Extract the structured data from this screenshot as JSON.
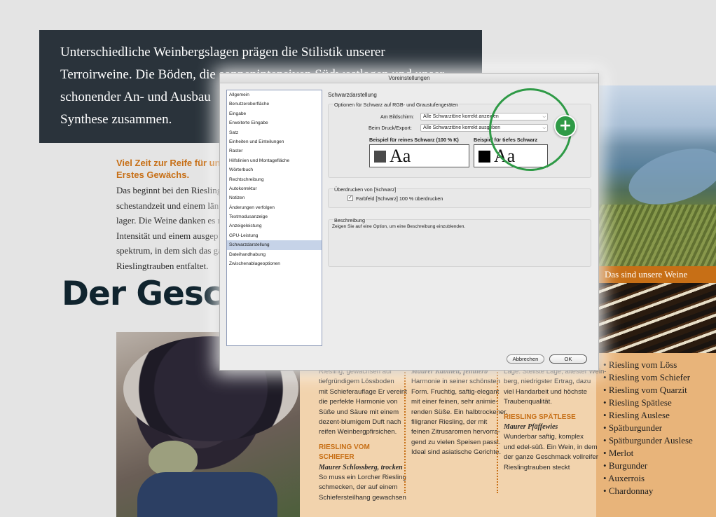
{
  "brochure": {
    "intro_lines": [
      "Unterschiedliche Weinbergslagen prägen die Stilistik unserer",
      "Terroirweine. Die Böden, die sonnenintensiven Südwestlagen und unser",
      "schonender An- und Ausbau",
      "Synthese zusammen."
    ],
    "orange_heading_lines": [
      "Viel Zeit zur Reife für un",
      "Erstes Gewächs."
    ],
    "body_lines": [
      "Das beginnt bei den Rieslinge",
      "schestandzeit und einem län",
      "lager. Die Weine danken es r",
      "Intensität und einem ausgep",
      "spektrum, in dem sich das ga",
      "Rieslingtrauben entfaltet."
    ],
    "big_heading": "Der Gesch",
    "band_title": "Das sind unsere Weine",
    "wine_list": [
      "Riesling vom Löss",
      "Riesling vom Schiefer",
      "Riesling vom Quarzit",
      "Riesling Spätlese",
      "Riesling Auslese",
      "Spätburgunder",
      "Spätburgunder Auslese",
      "Merlot",
      "Burgunder",
      "Auxerrois",
      "Chardonnay"
    ],
    "col1": {
      "lines": [
        "Riesling, gewachsen auf",
        "tiefgründigem Lössboden",
        "mit Schieferauflage Er vereint",
        "die perfekte Harmonie von",
        "Süße und Säure mit einem",
        "dezent-blumigem Duft nach",
        "reifen Weinbergpfirsichen."
      ],
      "heading_lines": [
        "RIESLING VOM",
        "SCHIEFER"
      ],
      "subtitle": "Maurer Schlossberg, trocken",
      "lines2": [
        "So muss ein Lorcher Riesling",
        "schmecken, der auf einem",
        "Schiefersteilhang gewachsen"
      ]
    },
    "col2": {
      "subtitle": "Maurer Kabinett, feinherb",
      "lines": [
        "Harmonie in seiner schönsten",
        "Form. Fruchtig, saftig-elegant",
        "mit einer feinen, sehr animie-",
        "renden Süße. Ein halbtrockener,",
        "filigraner Riesling, der mit",
        "feinen Zitrusaromen hervorra-",
        "gend zu vielen Speisen passt.",
        "Ideal sind asiatische Gerichte."
      ]
    },
    "col3": {
      "lines": [
        "Lage. Steilste Lage, ältester Wein-",
        "berg, niedrigster Ertrag, dazu",
        "viel Handarbeit und höchste",
        "Traubenqualität."
      ],
      "heading": "RIESLING SPÄTLESE",
      "subtitle": "Maurer Pfäffewies",
      "lines2": [
        "Wunderbar saftig, komplex",
        "und edel-süß. Ein Wein, in dem",
        "der ganze Geschmack vollreifer",
        "Rieslingtrauben steckt"
      ]
    }
  },
  "dialog": {
    "title": "Voreinstellungen",
    "sidebar": [
      "Allgemein",
      "Benutzeroberfläche",
      "Eingabe",
      "Erweiterte Eingabe",
      "Satz",
      "Einheiten und Einteilungen",
      "Raster",
      "Hilfslinien und Montagefläche",
      "Wörterbuch",
      "Rechtschreibung",
      "Autokorrektur",
      "Notizen",
      "Änderungen verfolgen",
      "Textmodusanzeige",
      "Anzeigeleistung",
      "GPU-Leistung",
      "Schwarzdarstellung",
      "Dateihandhabung",
      "Zwischenablageoptionen"
    ],
    "active_item": "Schwarzdarstellung",
    "panel_title": "Schwarzdarstellung",
    "group1_title": "Optionen für Schwarz auf RGB- und Graustufengeräten",
    "screen_label": "Am Bildschirm:",
    "screen_value": "Alle Schwarztöne korrekt anzeigen",
    "print_label": "Beim Druck/Export:",
    "print_value": "Alle Schwarztöne korrekt ausgeben",
    "sample_pure_label": "Beispiel für reines Schwarz (100 % K)",
    "sample_rich_label": "Beispiel für tiefes Schwarz",
    "sample_text": "Aa",
    "pure_black_color": "#4a4a4a",
    "rich_black_color": "#000000",
    "group2_title": "Überdrucken von [Schwarz]",
    "overprint_label": "Farbfeld [Schwarz] 100 % überdrucken",
    "overprint_checked": true,
    "group3_title": "Beschreibung",
    "description": "Zeigen Sie auf eine Option, um eine Beschreibung einzublenden.",
    "cancel_label": "Abbrechen",
    "ok_label": "OK"
  },
  "overlay": {
    "accent_color": "#2e9a46",
    "plus_symbol": "+"
  }
}
